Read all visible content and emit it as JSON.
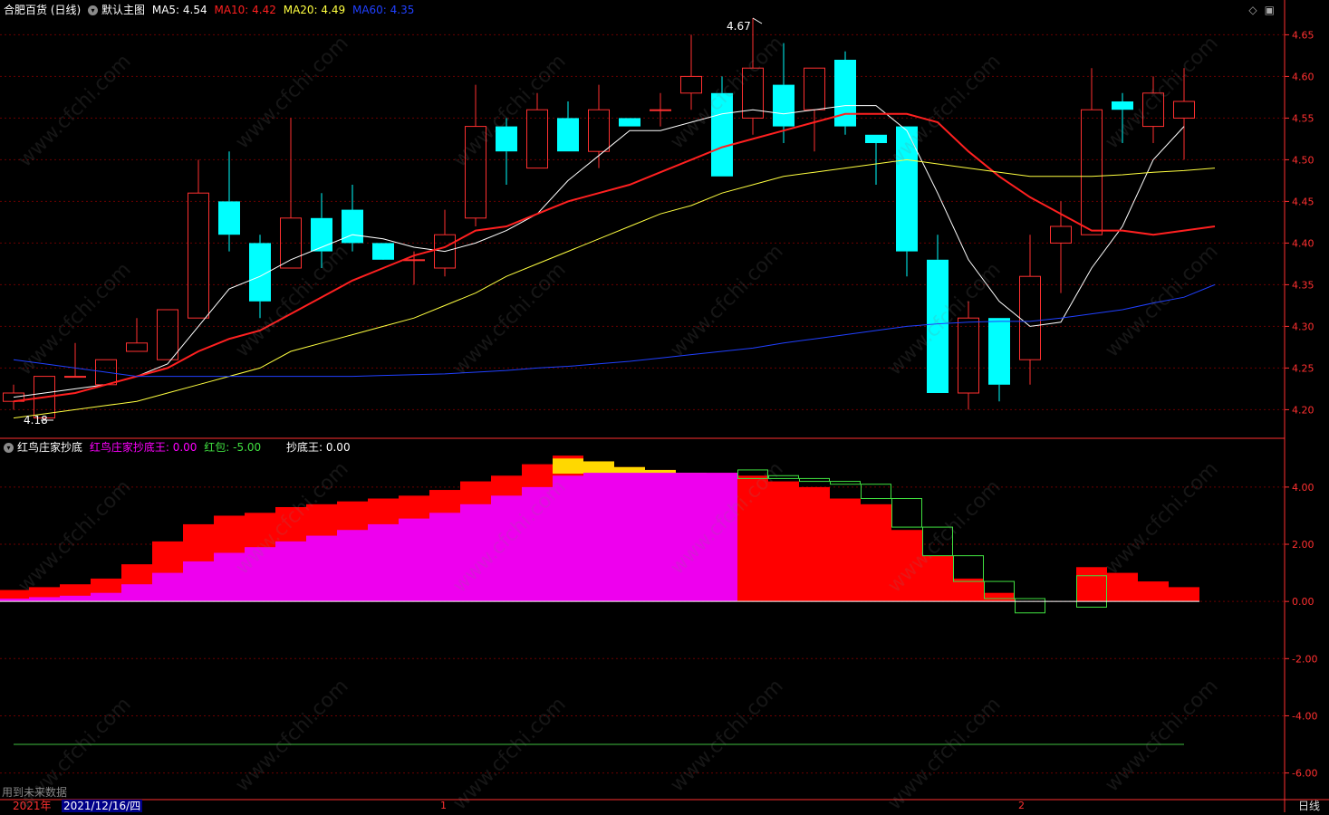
{
  "window": {
    "title": "合肥百货 (日线)",
    "template_label": "默认主图",
    "period_label": "日线"
  },
  "ma_legend": [
    {
      "label": "MA5: 4.54",
      "color": "#ffffff"
    },
    {
      "label": "MA10: 4.42",
      "color": "#ff2020"
    },
    {
      "label": "MA20: 4.49",
      "color": "#ffff40"
    },
    {
      "label": "MA60: 4.35",
      "color": "#2040ff"
    }
  ],
  "indicator_legend": {
    "name": "红鸟庄家抄底",
    "items": [
      {
        "label": "红鸟庄家抄底王: 0.00",
        "color": "#ff00ff"
      },
      {
        "label": "红包: -5.00",
        "color": "#40e040"
      },
      {
        "label": "抄底王: 0.00",
        "color": "#ffffff"
      }
    ]
  },
  "annotations": {
    "high": "4.67",
    "low": "4.18"
  },
  "footer": {
    "future_note": "用到未来数据",
    "year": "2021年",
    "cursor_date": "2021/12/16/四",
    "month_marks": [
      "1",
      "2"
    ]
  },
  "watermark": "www.cfchi.com",
  "colors": {
    "up": "#ff3030",
    "down": "#00ffff",
    "grid": "#6a0000",
    "axis": "#ff3030"
  },
  "chart_data": [
    {
      "type": "candlestick",
      "ylim": [
        4.17,
        4.67
      ],
      "y_ticks": [
        "4.65",
        "4.60",
        "4.55",
        "4.50",
        "4.45",
        "4.40",
        "4.35",
        "4.30",
        "4.25",
        "4.20"
      ],
      "candles": [
        [
          4.21,
          4.23,
          4.2,
          4.22
        ],
        [
          4.19,
          4.24,
          4.19,
          4.24
        ],
        [
          4.24,
          4.28,
          4.24,
          4.24
        ],
        [
          4.23,
          4.26,
          4.23,
          4.26
        ],
        [
          4.27,
          4.31,
          4.27,
          4.28
        ],
        [
          4.26,
          4.32,
          4.26,
          4.32
        ],
        [
          4.31,
          4.5,
          4.31,
          4.46
        ],
        [
          4.45,
          4.51,
          4.39,
          4.41
        ],
        [
          4.4,
          4.41,
          4.31,
          4.33
        ],
        [
          4.37,
          4.55,
          4.37,
          4.43
        ],
        [
          4.43,
          4.46,
          4.37,
          4.39
        ],
        [
          4.44,
          4.47,
          4.39,
          4.4
        ],
        [
          4.4,
          4.4,
          4.39,
          4.38
        ],
        [
          4.38,
          4.39,
          4.35,
          4.38
        ],
        [
          4.37,
          4.44,
          4.36,
          4.41
        ],
        [
          4.43,
          4.59,
          4.42,
          4.54
        ],
        [
          4.54,
          4.55,
          4.47,
          4.51
        ],
        [
          4.49,
          4.58,
          4.49,
          4.56
        ],
        [
          4.55,
          4.57,
          4.51,
          4.51
        ],
        [
          4.51,
          4.59,
          4.49,
          4.56
        ],
        [
          4.55,
          4.55,
          4.54,
          4.54
        ],
        [
          4.56,
          4.58,
          4.54,
          4.56
        ],
        [
          4.58,
          4.65,
          4.56,
          4.6
        ],
        [
          4.58,
          4.6,
          4.48,
          4.48
        ],
        [
          4.55,
          4.67,
          4.53,
          4.61
        ],
        [
          4.59,
          4.64,
          4.52,
          4.54
        ],
        [
          4.56,
          4.61,
          4.51,
          4.61
        ],
        [
          4.62,
          4.63,
          4.53,
          4.54
        ],
        [
          4.53,
          4.53,
          4.47,
          4.52
        ],
        [
          4.54,
          4.54,
          4.36,
          4.39
        ],
        [
          4.38,
          4.41,
          4.22,
          4.22
        ],
        [
          4.22,
          4.33,
          4.2,
          4.31
        ],
        [
          4.31,
          4.31,
          4.21,
          4.23
        ],
        [
          4.26,
          4.41,
          4.23,
          4.36
        ],
        [
          4.4,
          4.45,
          4.34,
          4.42
        ],
        [
          4.41,
          4.61,
          4.41,
          4.56
        ],
        [
          4.57,
          4.58,
          4.52,
          4.56
        ],
        [
          4.54,
          4.6,
          4.52,
          4.58
        ],
        [
          4.55,
          4.61,
          4.5,
          4.57
        ]
      ],
      "series": [
        {
          "name": "MA5",
          "values": [
            4.215,
            4.22,
            4.225,
            4.23,
            4.24,
            4.255,
            4.3,
            4.345,
            4.36,
            4.38,
            4.395,
            4.41,
            4.405,
            4.395,
            4.39,
            4.4,
            4.415,
            4.435,
            4.475,
            4.505,
            4.535,
            4.535,
            4.545,
            4.555,
            4.56,
            4.555,
            4.56,
            4.565,
            4.565,
            4.535,
            4.46,
            4.38,
            4.33,
            4.3,
            4.305,
            4.37,
            4.42,
            4.5,
            4.54
          ]
        },
        {
          "name": "MA10",
          "values": [
            4.21,
            4.215,
            4.22,
            4.23,
            4.24,
            4.25,
            4.27,
            4.285,
            4.295,
            4.315,
            4.335,
            4.355,
            4.37,
            4.385,
            4.395,
            4.415,
            4.42,
            4.435,
            4.45,
            4.46,
            4.47,
            4.485,
            4.5,
            4.515,
            4.525,
            4.535,
            4.545,
            4.555,
            4.555,
            4.555,
            4.545,
            4.51,
            4.48,
            4.455,
            4.435,
            4.415,
            4.415,
            4.41,
            4.415,
            4.42
          ]
        },
        {
          "name": "MA20",
          "values": [
            4.19,
            4.195,
            4.2,
            4.205,
            4.21,
            4.22,
            4.23,
            4.24,
            4.25,
            4.27,
            4.28,
            4.29,
            4.3,
            4.31,
            4.325,
            4.34,
            4.36,
            4.375,
            4.39,
            4.405,
            4.42,
            4.435,
            4.445,
            4.46,
            4.47,
            4.48,
            4.485,
            4.49,
            4.495,
            4.5,
            4.495,
            4.49,
            4.485,
            4.48,
            4.48,
            4.48,
            4.482,
            4.485,
            4.487,
            4.49
          ]
        },
        {
          "name": "MA60",
          "values": [
            4.26,
            4.255,
            4.25,
            4.245,
            4.24,
            4.24,
            4.24,
            4.24,
            4.24,
            4.24,
            4.24,
            4.24,
            4.241,
            4.242,
            4.243,
            4.245,
            4.247,
            4.25,
            4.252,
            4.255,
            4.258,
            4.262,
            4.266,
            4.27,
            4.274,
            4.28,
            4.285,
            4.29,
            4.295,
            4.3,
            4.303,
            4.305,
            4.306,
            4.306,
            4.31,
            4.315,
            4.32,
            4.328,
            4.335,
            4.35
          ]
        }
      ]
    },
    {
      "type": "bar",
      "ylim": [
        -6.9,
        5.2
      ],
      "y_ticks": [
        "4.00",
        "2.00",
        "0.00",
        "-2.00",
        "-4.00",
        "-6.00"
      ],
      "red_bars": [
        0.4,
        0.5,
        0.6,
        0.8,
        1.3,
        2.1,
        2.7,
        3.0,
        3.1,
        3.3,
        3.4,
        3.5,
        3.6,
        3.7,
        3.9,
        4.2,
        4.4,
        4.8,
        5.1,
        4.9,
        4.7,
        4.6,
        4.5,
        4.5,
        4.4,
        4.2,
        4.0,
        3.6,
        3.4,
        2.5,
        1.6,
        0.8,
        0.3,
        0,
        0,
        1.2,
        1.0,
        0.7,
        0.5
      ],
      "magenta_bars": [
        0.1,
        0.15,
        0.2,
        0.3,
        0.6,
        1.0,
        1.4,
        1.7,
        1.9,
        2.1,
        2.3,
        2.5,
        2.7,
        2.9,
        3.1,
        3.4,
        3.7,
        4.0,
        4.4,
        4.5,
        4.5,
        4.5,
        4.5,
        4.5,
        0,
        0,
        0,
        0,
        0,
        0,
        0,
        0,
        0,
        0,
        0,
        0,
        0,
        0,
        0
      ],
      "yellow_bars": [
        0,
        0,
        0,
        0,
        0,
        0,
        0,
        0,
        0,
        0,
        0,
        0,
        0,
        0,
        0,
        0,
        0,
        0,
        5.0,
        4.9,
        4.7,
        4.6,
        4.5,
        0,
        0,
        0,
        0,
        0,
        0,
        0,
        0,
        0,
        0,
        0,
        0,
        0,
        0,
        0,
        0
      ],
      "green_boxes": [
        [
          24,
          4.6,
          4.3
        ],
        [
          25,
          4.4,
          4.3
        ],
        [
          26,
          4.3,
          4.2
        ],
        [
          27,
          4.2,
          4.1
        ],
        [
          28,
          4.1,
          3.6
        ],
        [
          29,
          3.6,
          2.6
        ],
        [
          30,
          2.6,
          1.6
        ],
        [
          31,
          1.6,
          0.7
        ],
        [
          32,
          0.7,
          0.1
        ],
        [
          33,
          0.1,
          -0.4
        ],
        [
          35,
          0.9,
          -0.2
        ]
      ],
      "hongbao_line": -5.0
    }
  ]
}
